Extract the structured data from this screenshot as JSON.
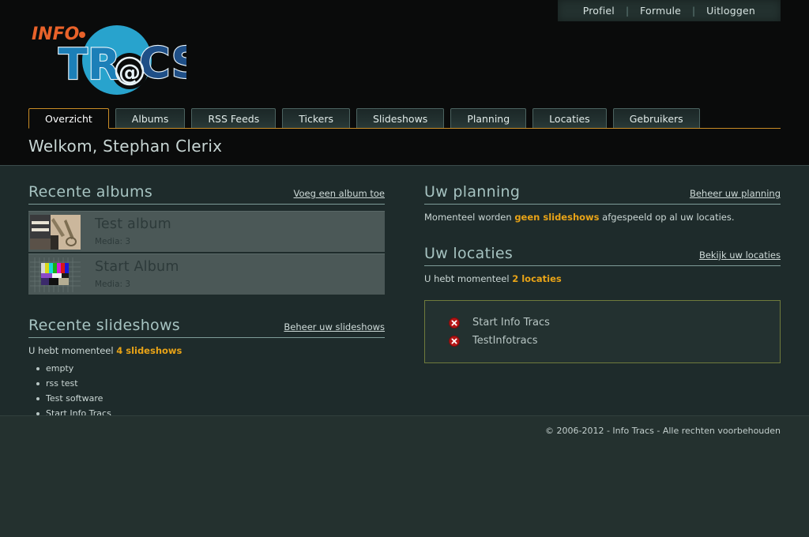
{
  "topnav": {
    "items": [
      {
        "label": "Profiel"
      },
      {
        "label": "Formule"
      },
      {
        "label": "Uitloggen"
      }
    ],
    "separator": "|"
  },
  "logo": {
    "info_text": "INFO·",
    "tracs_text": "TR@CS",
    "circle_color": "#28a3cd",
    "info_color": "#e8622a",
    "tr_color": "#1c7fb8",
    "cs_color": "#1f4f87",
    "outline_color": "#e9f4fa"
  },
  "tabs": [
    {
      "label": "Overzicht",
      "active": true
    },
    {
      "label": "Albums",
      "active": false
    },
    {
      "label": "RSS Feeds",
      "active": false
    },
    {
      "label": "Tickers",
      "active": false
    },
    {
      "label": "Slideshows",
      "active": false
    },
    {
      "label": "Planning",
      "active": false
    },
    {
      "label": "Locaties",
      "active": false
    },
    {
      "label": "Gebruikers",
      "active": false
    }
  ],
  "welcome": "Welkom, Stephan Clerix",
  "left": {
    "albums": {
      "title": "Recente albums",
      "action_label": "Voeg een album toe",
      "items": [
        {
          "title": "Test album",
          "meta": "Media: 3",
          "thumb": "photo-workbench"
        },
        {
          "title": "Start Album",
          "meta": "Media: 3",
          "thumb": "test-pattern"
        }
      ]
    },
    "slideshows": {
      "title": "Recente slideshows",
      "action_label": "Beheer uw slideshows",
      "count_prefix": "U hebt momenteel ",
      "count_value": "4 slideshows",
      "items": [
        {
          "label": "empty"
        },
        {
          "label": "rss test"
        },
        {
          "label": "Test software"
        },
        {
          "label": "Start Info Tracs"
        }
      ]
    }
  },
  "right": {
    "planning": {
      "title": "Uw planning",
      "action_label": "Beheer uw planning",
      "text_before": "Momenteel worden ",
      "text_highlight": "geen slideshows",
      "text_after": " afgespeeld op al uw locaties."
    },
    "locations": {
      "title": "Uw locaties",
      "action_label": "Bekijk uw locaties",
      "count_prefix": "U hebt momenteel ",
      "count_value": "2 locaties",
      "items": [
        {
          "label": "Start Info Tracs",
          "status_icon": "red-x-icon"
        },
        {
          "label": "TestInfotracs",
          "status_icon": "red-x-icon"
        }
      ]
    }
  },
  "footer": {
    "copyright": "© 2006-2012 - Info Tracs - Alle rechten voorbehouden"
  },
  "colors": {
    "accent_orange": "#c98c26",
    "highlight_amber": "#e8a317",
    "heading": "#a6c3c1",
    "page_bg": "#1e2b2b",
    "header_bg": "#0a0b0b",
    "footer_bg": "#24312f",
    "locbox_border": "#6f7a3c"
  }
}
